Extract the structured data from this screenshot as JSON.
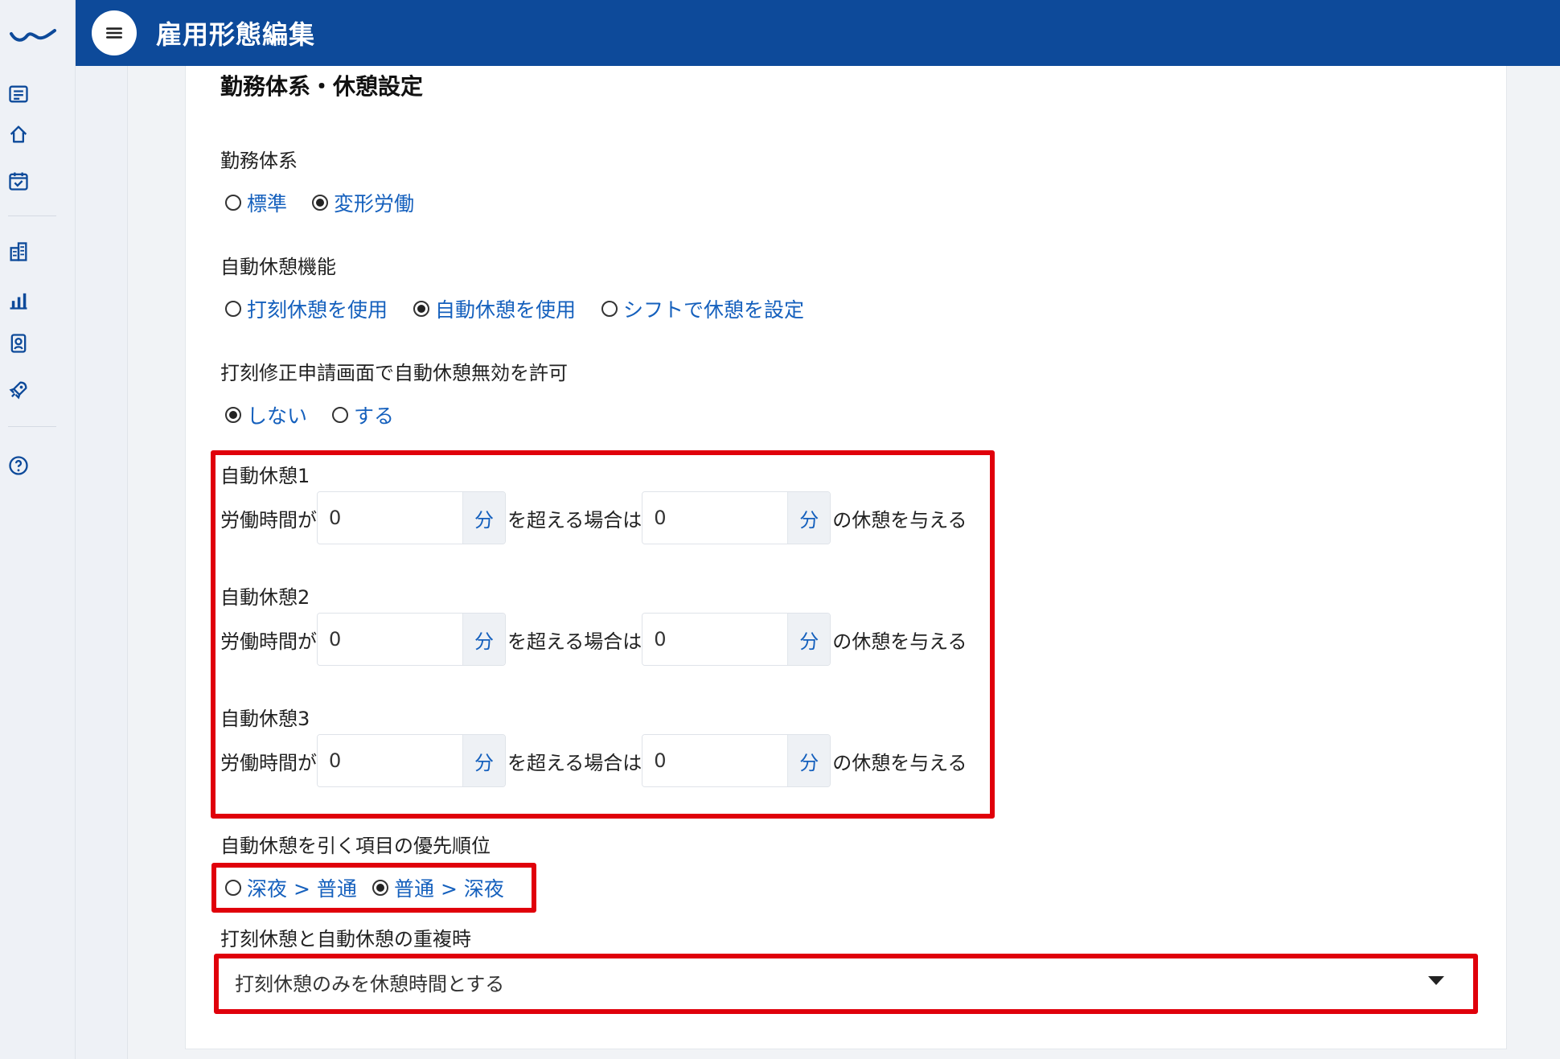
{
  "header": {
    "title": "雇用形態編集"
  },
  "section": {
    "title": "勤務体系・休憩設定"
  },
  "work_system": {
    "label": "勤務体系",
    "options": [
      {
        "label": "標準",
        "selected": false
      },
      {
        "label": "変形労働",
        "selected": true
      }
    ]
  },
  "auto_break_function": {
    "label": "自動休憩機能",
    "options": [
      {
        "label": "打刻休憩を使用",
        "selected": false
      },
      {
        "label": "自動休憩を使用",
        "selected": true
      },
      {
        "label": "シフトで休憩を設定",
        "selected": false
      }
    ]
  },
  "allow_invalidate": {
    "label": "打刻修正申請画面で自動休憩無効を許可",
    "options": [
      {
        "label": "しない",
        "selected": true
      },
      {
        "label": "する",
        "selected": false
      }
    ]
  },
  "auto_breaks": {
    "text_prefix": "労働時間が",
    "text_middle": "を超える場合は",
    "text_suffix": "の休憩を与える",
    "unit": "分",
    "items": [
      {
        "title": "自動休憩1",
        "work_minutes": "0",
        "break_minutes": "0"
      },
      {
        "title": "自動休憩2",
        "work_minutes": "0",
        "break_minutes": "0"
      },
      {
        "title": "自動休憩3",
        "work_minutes": "0",
        "break_minutes": "0"
      }
    ]
  },
  "priority": {
    "label": "自動休憩を引く項目の優先順位",
    "options": [
      {
        "label": "深夜 > 普通",
        "selected": false
      },
      {
        "label": "普通 > 深夜",
        "selected": true
      }
    ]
  },
  "overlap": {
    "label": "打刻休憩と自動休憩の重複時",
    "selected_value": "打刻休憩のみを休憩時間とする"
  },
  "colors": {
    "header_bg": "#0d4a9a",
    "link_blue": "#1560bd",
    "highlight_red": "#e0000b"
  },
  "sidebar_icons": [
    "logo-icon",
    "list-icon",
    "home-icon",
    "calendar-check-icon",
    "building-icon",
    "bar-chart-icon",
    "id-card-icon",
    "rocket-icon",
    "help-icon"
  ]
}
